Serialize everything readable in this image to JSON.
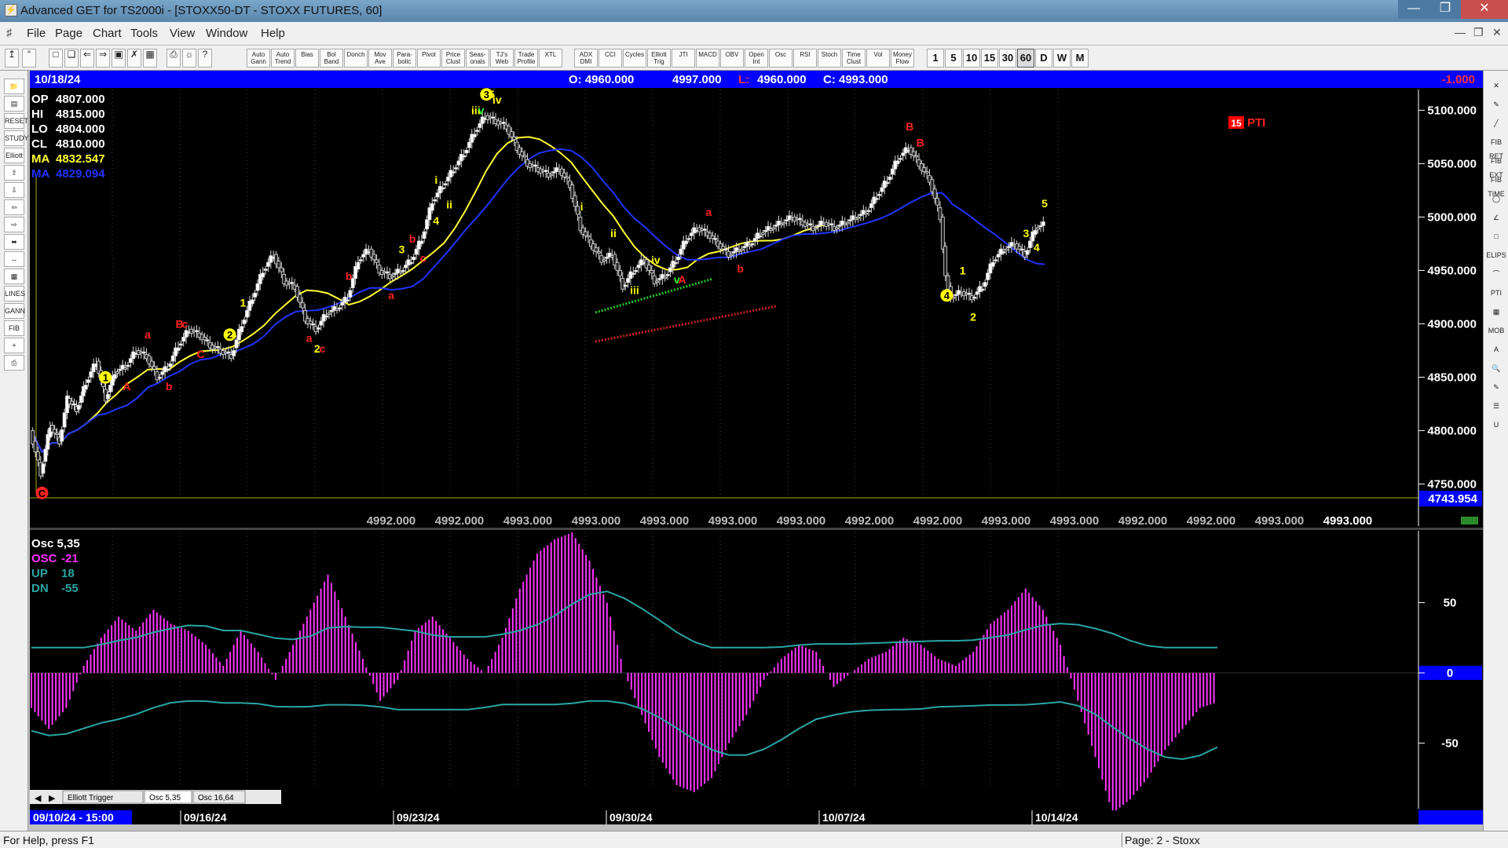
{
  "window": {
    "title": "Advanced GET for TS2000i - [STOXX50-DT - STOXX FUTURES, 60]",
    "min_icon": "minimize-icon",
    "max_icon": "maximize-icon",
    "close_icon": "close-icon"
  },
  "menu": {
    "items": [
      "File",
      "Page",
      "Chart",
      "Tools",
      "View",
      "Window",
      "Help"
    ]
  },
  "toolbar": {
    "studies": [
      "Auto Gann",
      "Auto Trend",
      "Bias",
      "Bol Band",
      "Donch",
      "Mov Ave",
      "Para-bolic",
      "Pivot",
      "Price Clust",
      "Seas-onals",
      "TJ's Web",
      "Trade Profile",
      "XTL",
      "ADX DMI",
      "CCI",
      "Cycles",
      "Elliott Trig",
      "JTI",
      "MACD",
      "OBV",
      "Open Int",
      "Osc",
      "RSI",
      "Stoch",
      "Time Clust",
      "Vol",
      "Money Flow"
    ],
    "periods": [
      "1",
      "5",
      "10",
      "15",
      "30",
      "60",
      "D",
      "W",
      "M"
    ],
    "active_period": "60"
  },
  "left_tools": [
    "RESET",
    "STUDY",
    "Elliott",
    "LINES",
    "GANN",
    "FIB"
  ],
  "right_tools": [
    "FIB RET",
    "FIB EXT",
    "FIB TIME",
    "ELIPS",
    "PTI",
    "MOB"
  ],
  "header": {
    "date": "10/18/24",
    "open": "O: 4960.000",
    "high": "4997.000",
    "low_label": "L:",
    "low": "4960.000",
    "close": "C: 4993.000",
    "change": "-1.000"
  },
  "info_box": [
    {
      "label": "OP",
      "value": "4807.000",
      "color": "#ffffff"
    },
    {
      "label": "HI",
      "value": "4815.000",
      "color": "#ffffff"
    },
    {
      "label": "LO",
      "value": "4804.000",
      "color": "#ffffff"
    },
    {
      "label": "CL",
      "value": "4810.000",
      "color": "#ffffff"
    },
    {
      "label": "MA",
      "value": "4832.547",
      "color": "#ffff33"
    },
    {
      "label": "MA",
      "value": "4829.094",
      "color": "#2233ff"
    }
  ],
  "price_axis": {
    "ticks": [
      "5100.000",
      "5050.000",
      "5000.000",
      "4950.000",
      "4900.000",
      "4850.000",
      "4800.000",
      "4750.000"
    ],
    "current": "4743.954"
  },
  "bottom_values": [
    "4992.000",
    "4992.000",
    "4993.000",
    "4993.000",
    "4993.000",
    "4993.000",
    "4993.000",
    "4992.000",
    "4992.000",
    "4993.000",
    "4993.000",
    "4992.000",
    "4992.000",
    "4993.000",
    "4993.000"
  ],
  "pti": {
    "badge": "15",
    "label": "PTI"
  },
  "osc_box": [
    {
      "label": "Osc 5,35",
      "value": "",
      "color": "#ffffff"
    },
    {
      "label": "OSC",
      "value": "-21",
      "color": "#ff33ff"
    },
    {
      "label": "UP",
      "value": "18",
      "color": "#2aa5a5"
    },
    {
      "label": "DN",
      "value": "-55",
      "color": "#2aa5a5"
    }
  ],
  "osc_axis": {
    "ticks": [
      "50",
      "0",
      "-50"
    ]
  },
  "tabs": [
    "Elliott Trigger",
    "Osc 5,35",
    "Osc 16,64"
  ],
  "date_axis": {
    "first": "09/10/24 - 15:00",
    "labels": [
      "09/16/24",
      "09/23/24",
      "09/30/24",
      "10/07/24",
      "10/14/24"
    ]
  },
  "waves": [
    {
      "text": "1",
      "color": "#ffff00",
      "circled": true
    },
    {
      "text": "2",
      "color": "#ffff00",
      "circled": true
    },
    {
      "text": "3",
      "color": "#ffff00",
      "circled": true
    },
    {
      "text": "4",
      "color": "#ffff00",
      "circled": true
    },
    {
      "text": "C",
      "color": "#ff2222",
      "circled": true
    },
    {
      "text": "A",
      "color": "#ff2222"
    },
    {
      "text": "a",
      "color": "#ff2222"
    },
    {
      "text": "b",
      "color": "#ff2222"
    },
    {
      "text": "B",
      "color": "#ff2222"
    },
    {
      "text": "c",
      "color": "#ff2222"
    },
    {
      "text": "C",
      "color": "#ff2222"
    },
    {
      "text": "1",
      "color": "#ffff00"
    },
    {
      "text": "a",
      "color": "#ff2222"
    },
    {
      "text": "b",
      "color": "#ff2222"
    },
    {
      "text": "c",
      "color": "#ff2222"
    },
    {
      "text": "2",
      "color": "#ffff00"
    },
    {
      "text": "3",
      "color": "#ffff00"
    },
    {
      "text": "b",
      "color": "#ff2222"
    },
    {
      "text": "a",
      "color": "#ff2222"
    },
    {
      "text": "c",
      "color": "#ff2222"
    },
    {
      "text": "i",
      "color": "#ffff00"
    },
    {
      "text": "4",
      "color": "#ffff00"
    },
    {
      "text": "ii",
      "color": "#ffff00"
    },
    {
      "text": "iii",
      "color": "#ffff00"
    },
    {
      "text": "iv",
      "color": "#ffff00"
    },
    {
      "text": "5",
      "color": "#ffff00"
    },
    {
      "text": "v",
      "color": "#33ff33"
    },
    {
      "text": "i",
      "color": "#ffff00"
    },
    {
      "text": "ii",
      "color": "#ffff00"
    },
    {
      "text": "iii",
      "color": "#ffff00"
    },
    {
      "text": "iv",
      "color": "#ffff00"
    },
    {
      "text": "v",
      "color": "#33ff33"
    },
    {
      "text": "A",
      "color": "#ff2222"
    },
    {
      "text": "a",
      "color": "#ff2222"
    },
    {
      "text": "b",
      "color": "#ff2222"
    },
    {
      "text": "B",
      "color": "#ff2222"
    },
    {
      "text": "B",
      "color": "#ff2222"
    },
    {
      "text": "1",
      "color": "#ffff00"
    },
    {
      "text": "2",
      "color": "#ffff00"
    },
    {
      "text": "3",
      "color": "#ffff00"
    },
    {
      "text": "4",
      "color": "#ffff00"
    },
    {
      "text": "5",
      "color": "#ffff00"
    }
  ],
  "colors": {
    "ma_fast": "#ffff33",
    "ma_slow": "#2233ff",
    "osc_bar": "#ff33ff",
    "band": "#2aa5a5",
    "header_bar": "#0000ff",
    "pti_badge": "#ff0000"
  },
  "chart_data": {
    "type": "candlestick",
    "price_range": [
      4740,
      5115
    ],
    "osc_range": [
      -80,
      90
    ],
    "series": [
      {
        "name": "price",
        "points": [
          [
            0,
            4800
          ],
          [
            8,
            4760
          ],
          [
            15,
            4805
          ],
          [
            22,
            4790
          ],
          [
            28,
            4830
          ],
          [
            35,
            4820
          ],
          [
            42,
            4845
          ],
          [
            50,
            4865
          ],
          [
            57,
            4830
          ],
          [
            64,
            4855
          ],
          [
            72,
            4860
          ],
          [
            80,
            4875
          ],
          [
            88,
            4870
          ],
          [
            96,
            4850
          ],
          [
            104,
            4860
          ],
          [
            112,
            4880
          ],
          [
            120,
            4895
          ],
          [
            128,
            4890
          ],
          [
            136,
            4880
          ],
          [
            144,
            4875
          ],
          [
            152,
            4870
          ],
          [
            160,
            4900
          ],
          [
            168,
            4925
          ],
          [
            176,
            4950
          ],
          [
            184,
            4965
          ],
          [
            192,
            4940
          ],
          [
            200,
            4935
          ],
          [
            208,
            4905
          ],
          [
            216,
            4895
          ],
          [
            224,
            4910
          ],
          [
            232,
            4915
          ],
          [
            240,
            4925
          ],
          [
            248,
            4960
          ],
          [
            256,
            4970
          ],
          [
            264,
            4950
          ],
          [
            272,
            4945
          ],
          [
            280,
            4950
          ],
          [
            288,
            4960
          ],
          [
            296,
            4980
          ],
          [
            304,
            5015
          ],
          [
            312,
            5030
          ],
          [
            320,
            5045
          ],
          [
            328,
            5060
          ],
          [
            336,
            5080
          ],
          [
            344,
            5095
          ],
          [
            352,
            5090
          ],
          [
            360,
            5085
          ],
          [
            368,
            5065
          ],
          [
            376,
            5050
          ],
          [
            384,
            5045
          ],
          [
            392,
            5040
          ],
          [
            400,
            5045
          ],
          [
            408,
            5030
          ],
          [
            416,
            4990
          ],
          [
            424,
            4975
          ],
          [
            432,
            4960
          ],
          [
            440,
            4965
          ],
          [
            448,
            4935
          ],
          [
            456,
            4950
          ],
          [
            464,
            4960
          ],
          [
            472,
            4940
          ],
          [
            480,
            4945
          ],
          [
            488,
            4960
          ],
          [
            496,
            4980
          ],
          [
            504,
            4990
          ],
          [
            512,
            4985
          ],
          [
            520,
            4975
          ],
          [
            528,
            4965
          ],
          [
            536,
            4970
          ],
          [
            544,
            4975
          ],
          [
            552,
            4985
          ],
          [
            560,
            4990
          ],
          [
            568,
            4995
          ],
          [
            576,
            5000
          ],
          [
            584,
            4995
          ],
          [
            592,
            4990
          ],
          [
            600,
            4995
          ],
          [
            608,
            4990
          ],
          [
            616,
            4995
          ],
          [
            624,
            5000
          ],
          [
            632,
            5005
          ],
          [
            640,
            5020
          ],
          [
            648,
            5035
          ],
          [
            656,
            5055
          ],
          [
            664,
            5065
          ],
          [
            672,
            5050
          ],
          [
            680,
            5035
          ],
          [
            688,
            5000
          ],
          [
            692,
            4945
          ],
          [
            696,
            4925
          ],
          [
            704,
            4930
          ],
          [
            712,
            4925
          ],
          [
            720,
            4935
          ],
          [
            728,
            4960
          ],
          [
            736,
            4970
          ],
          [
            744,
            4975
          ],
          [
            752,
            4965
          ],
          [
            760,
            4990
          ],
          [
            766,
            4993
          ]
        ]
      },
      {
        "name": "osc",
        "points": [
          [
            0,
            -25
          ],
          [
            10,
            -40
          ],
          [
            20,
            -25
          ],
          [
            30,
            5
          ],
          [
            40,
            25
          ],
          [
            50,
            40
          ],
          [
            60,
            30
          ],
          [
            70,
            45
          ],
          [
            80,
            35
          ],
          [
            90,
            30
          ],
          [
            100,
            20
          ],
          [
            110,
            5
          ],
          [
            120,
            30
          ],
          [
            130,
            15
          ],
          [
            140,
            -5
          ],
          [
            150,
            20
          ],
          [
            160,
            45
          ],
          [
            170,
            70
          ],
          [
            180,
            40
          ],
          [
            190,
            10
          ],
          [
            200,
            -20
          ],
          [
            210,
            -5
          ],
          [
            220,
            30
          ],
          [
            230,
            40
          ],
          [
            240,
            25
          ],
          [
            250,
            10
          ],
          [
            260,
            0
          ],
          [
            270,
            25
          ],
          [
            280,
            60
          ],
          [
            290,
            85
          ],
          [
            300,
            95
          ],
          [
            310,
            100
          ],
          [
            320,
            80
          ],
          [
            330,
            50
          ],
          [
            340,
            0
          ],
          [
            350,
            -30
          ],
          [
            360,
            -60
          ],
          [
            370,
            -80
          ],
          [
            380,
            -85
          ],
          [
            390,
            -75
          ],
          [
            400,
            -50
          ],
          [
            410,
            -30
          ],
          [
            420,
            -5
          ],
          [
            430,
            10
          ],
          [
            440,
            20
          ],
          [
            450,
            15
          ],
          [
            460,
            -10
          ],
          [
            470,
            0
          ],
          [
            480,
            10
          ],
          [
            490,
            15
          ],
          [
            500,
            25
          ],
          [
            510,
            20
          ],
          [
            520,
            10
          ],
          [
            530,
            5
          ],
          [
            540,
            15
          ],
          [
            550,
            35
          ],
          [
            560,
            45
          ],
          [
            570,
            60
          ],
          [
            580,
            45
          ],
          [
            590,
            20
          ],
          [
            600,
            -20
          ],
          [
            610,
            -60
          ],
          [
            620,
            -100
          ],
          [
            630,
            -90
          ],
          [
            640,
            -75
          ],
          [
            650,
            -55
          ],
          [
            660,
            -40
          ],
          [
            670,
            -25
          ],
          [
            680,
            -21
          ]
        ]
      }
    ]
  }
}
